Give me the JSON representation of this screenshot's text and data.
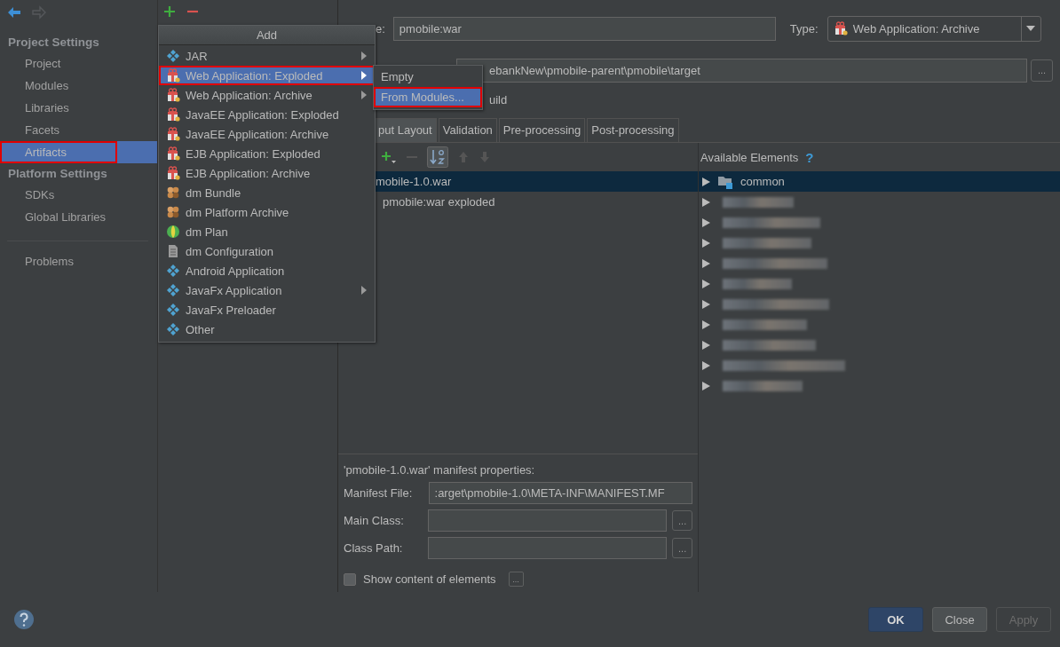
{
  "sidebar": {
    "sections": [
      {
        "heading": "Project Settings",
        "items": [
          {
            "label": "Project",
            "selected": false,
            "annotated": false
          },
          {
            "label": "Modules",
            "selected": false,
            "annotated": false
          },
          {
            "label": "Libraries",
            "selected": false,
            "annotated": false
          },
          {
            "label": "Facets",
            "selected": false,
            "annotated": false
          },
          {
            "label": "Artifacts",
            "selected": true,
            "annotated": true
          }
        ]
      },
      {
        "heading": "Platform Settings",
        "items": [
          {
            "label": "SDKs",
            "selected": false,
            "annotated": false
          },
          {
            "label": "Global Libraries",
            "selected": false,
            "annotated": false
          }
        ]
      }
    ],
    "footer_items": [
      {
        "label": "Problems",
        "selected": false,
        "annotated": false
      }
    ]
  },
  "menu": {
    "title": "Add",
    "items": [
      {
        "label": "JAR",
        "kind": "diamond",
        "submenu": true,
        "selected": false,
        "annotated": false
      },
      {
        "label": "Web Application: Exploded",
        "kind": "gift",
        "submenu": true,
        "selected": true,
        "annotated": true
      },
      {
        "label": "Web Application: Archive",
        "kind": "gift",
        "submenu": true,
        "selected": false,
        "annotated": false
      },
      {
        "label": "JavaEE Application: Exploded",
        "kind": "gift",
        "submenu": false,
        "selected": false,
        "annotated": false
      },
      {
        "label": "JavaEE Application: Archive",
        "kind": "gift",
        "submenu": false,
        "selected": false,
        "annotated": false
      },
      {
        "label": "EJB Application: Exploded",
        "kind": "gift",
        "submenu": false,
        "selected": false,
        "annotated": false
      },
      {
        "label": "EJB Application: Archive",
        "kind": "gift",
        "submenu": false,
        "selected": false,
        "annotated": false
      },
      {
        "label": "dm Bundle",
        "kind": "bundle",
        "submenu": false,
        "selected": false,
        "annotated": false
      },
      {
        "label": "dm Platform Archive",
        "kind": "bundle",
        "submenu": false,
        "selected": false,
        "annotated": false
      },
      {
        "label": "dm Plan",
        "kind": "globe",
        "submenu": false,
        "selected": false,
        "annotated": false
      },
      {
        "label": "dm Configuration",
        "kind": "document",
        "submenu": false,
        "selected": false,
        "annotated": false
      },
      {
        "label": "Android Application",
        "kind": "diamond",
        "submenu": false,
        "selected": false,
        "annotated": false
      },
      {
        "label": "JavaFx Application",
        "kind": "diamond",
        "submenu": true,
        "selected": false,
        "annotated": false
      },
      {
        "label": "JavaFx Preloader",
        "kind": "diamond",
        "submenu": false,
        "selected": false,
        "annotated": false
      },
      {
        "label": "Other",
        "kind": "diamond",
        "submenu": false,
        "selected": false,
        "annotated": false
      }
    ]
  },
  "submenu": {
    "items": [
      {
        "label": "Empty",
        "selected": false,
        "annotated": false
      },
      {
        "label": "From Modules...",
        "selected": true,
        "annotated": true
      }
    ]
  },
  "editor": {
    "name_label": "e:",
    "name_value": "pmobile:war",
    "type_label": "Type:",
    "type_value": "Web Application: Archive",
    "output_path": "ebankNew\\pmobile-parent\\pmobile\\target",
    "browse_label": "...",
    "build_label": "uild",
    "tabs": [
      {
        "label": "put Layout",
        "selected": true
      },
      {
        "label": "Validation",
        "selected": false
      },
      {
        "label": "Pre-processing",
        "selected": false
      },
      {
        "label": "Post-processing",
        "selected": false
      }
    ],
    "layout_tree": [
      {
        "label": "mobile-1.0.war",
        "selected": true
      },
      {
        "label": "pmobile:war exploded",
        "selected": false
      }
    ],
    "available_title": "Available Elements",
    "available_help": "?",
    "available": [
      {
        "label": "common",
        "selected": true,
        "redacted": false
      },
      {
        "redacted": true,
        "selected": false
      },
      {
        "redacted": true,
        "selected": false
      },
      {
        "redacted": true,
        "selected": false
      },
      {
        "redacted": true,
        "selected": false
      },
      {
        "redacted": true,
        "selected": false
      },
      {
        "redacted": true,
        "selected": false
      },
      {
        "redacted": true,
        "selected": false
      },
      {
        "redacted": true,
        "selected": false
      },
      {
        "redacted": true,
        "selected": false
      },
      {
        "redacted": true,
        "selected": false
      }
    ],
    "manifest": {
      "title": "'pmobile-1.0.war' manifest properties:",
      "fields": [
        {
          "label": "Manifest File:",
          "value": ":arget\\pmobile-1.0\\META-INF\\MANIFEST.MF",
          "browse": false
        },
        {
          "label": "Main Class:",
          "browse": true,
          "browse_label": "..."
        },
        {
          "label": "Class Path:",
          "browse": true,
          "browse_label": "..."
        }
      ]
    },
    "show_content": {
      "label": "Show content of elements",
      "checked": false,
      "more_label": "..."
    }
  },
  "buttons": [
    {
      "label": "OK",
      "kind": "primary",
      "disabled": false
    },
    {
      "label": "Close",
      "kind": "normal",
      "disabled": false
    },
    {
      "label": "Apply",
      "kind": "normal",
      "disabled": true
    }
  ]
}
